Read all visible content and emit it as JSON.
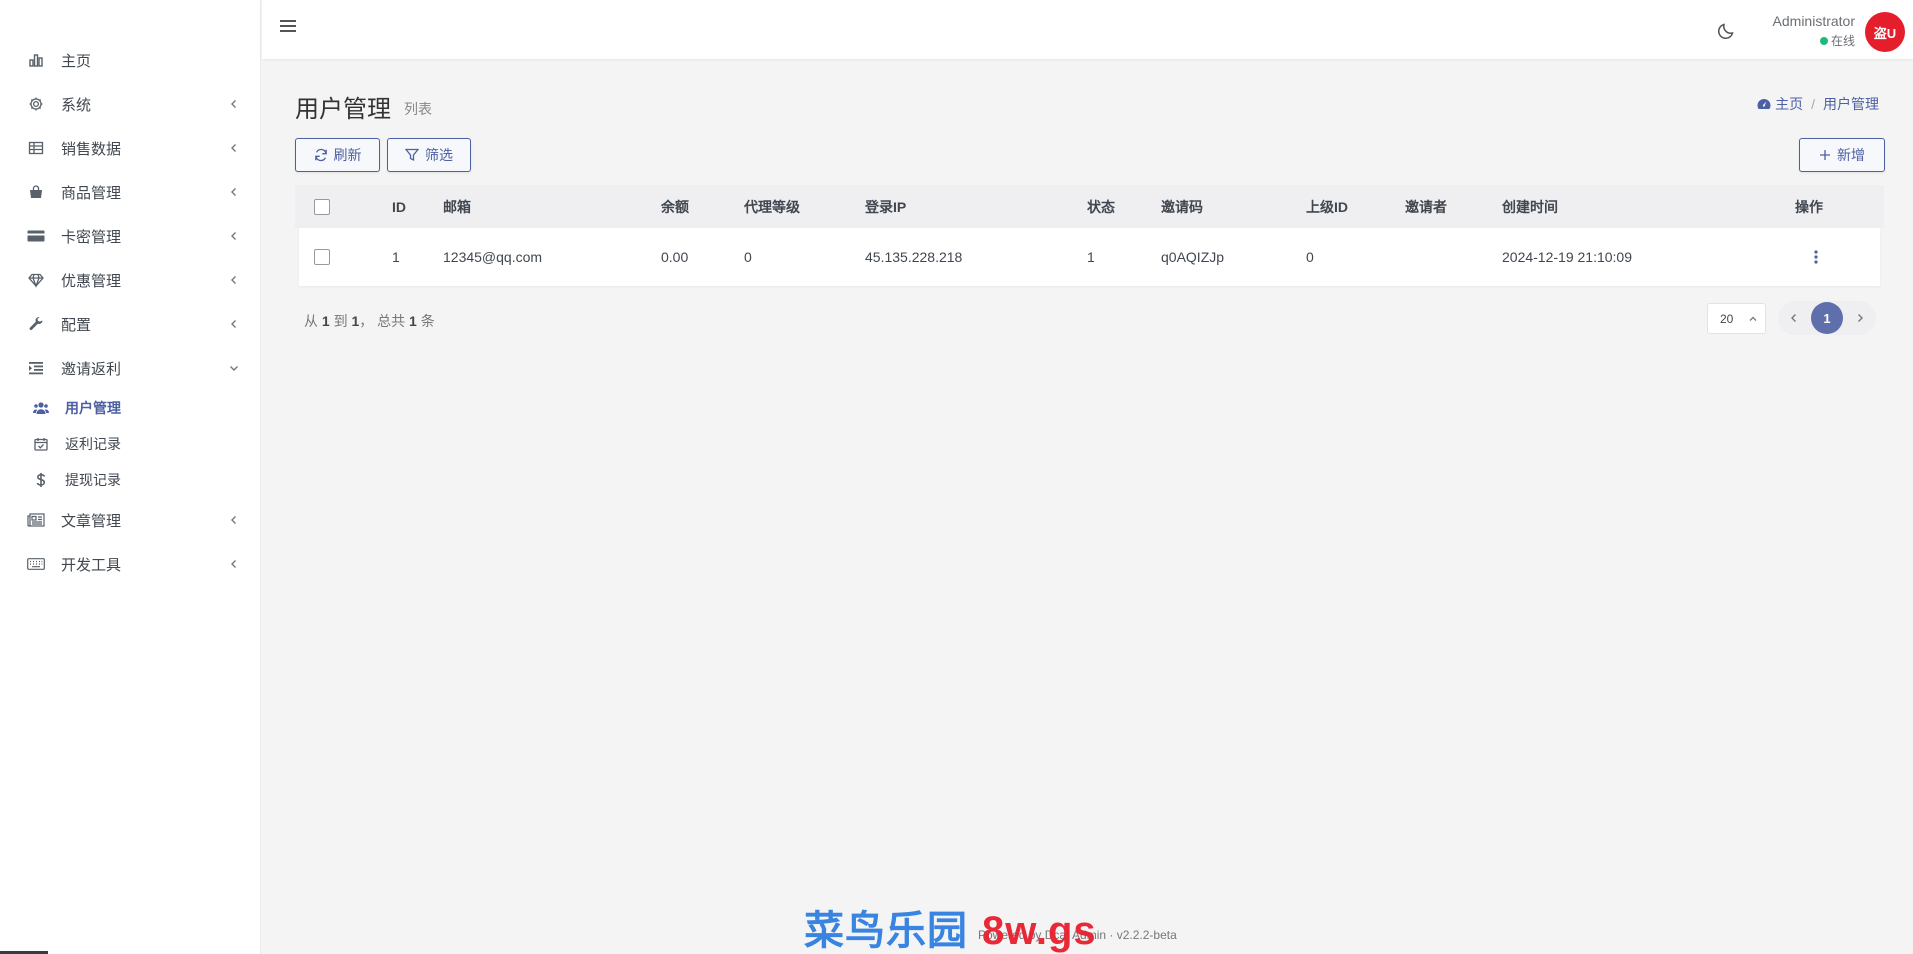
{
  "sidebar": {
    "items": [
      {
        "label": "主页",
        "icon": "bar-chart-icon",
        "arrow": false
      },
      {
        "label": "系统",
        "icon": "gear-icon",
        "arrow": true
      },
      {
        "label": "销售数据",
        "icon": "table-icon",
        "arrow": true
      },
      {
        "label": "商品管理",
        "icon": "shopping-bag-icon",
        "arrow": true
      },
      {
        "label": "卡密管理",
        "icon": "credit-card-icon",
        "arrow": true
      },
      {
        "label": "优惠管理",
        "icon": "diamond-icon",
        "arrow": true
      },
      {
        "label": "配置",
        "icon": "wrench-icon",
        "arrow": true
      },
      {
        "label": "邀请返利",
        "icon": "indent-icon",
        "arrow": true,
        "expanded": true
      }
    ],
    "sub_items": [
      {
        "label": "用户管理",
        "icon": "users-icon",
        "active": true
      },
      {
        "label": "返利记录",
        "icon": "calendar-check-icon",
        "active": false
      },
      {
        "label": "提现记录",
        "icon": "dollar-icon",
        "active": false
      }
    ],
    "items_after": [
      {
        "label": "文章管理",
        "icon": "newspaper-icon",
        "arrow": true
      },
      {
        "label": "开发工具",
        "icon": "keyboard-icon",
        "arrow": true
      }
    ]
  },
  "topbar": {
    "user_name": "Administrator",
    "user_status": "在线",
    "avatar_text": "盗U",
    "status_color": "#21b978",
    "avatar_color": "#e41e2b"
  },
  "page": {
    "title": "用户管理",
    "subtitle": "列表",
    "breadcrumb_home": "主页",
    "breadcrumb_sep": "/",
    "breadcrumb_current": "用户管理"
  },
  "toolbar": {
    "refresh_label": "刷新",
    "filter_label": "筛选",
    "add_label": "新增"
  },
  "table": {
    "columns": [
      "ID",
      "邮箱",
      "余额",
      "代理等级",
      "登录IP",
      "状态",
      "邀请码",
      "上级ID",
      "邀请者",
      "创建时间",
      "操作"
    ],
    "rows": [
      [
        "1",
        "12345@qq.com",
        "0.00",
        "0",
        "45.135.228.218",
        "1",
        "q0AQIZJp",
        "0",
        "",
        "2024-12-19 21:10:09"
      ]
    ]
  },
  "pagination": {
    "summary_from": "从",
    "summary_start": "1",
    "summary_to": "到",
    "summary_end": "1",
    "summary_total_label": "， 总共",
    "summary_total": "1",
    "summary_unit": "条",
    "per_page": "20",
    "current_page": "1"
  },
  "footer": {
    "text": "Powered by Dcat Admin · v2.2.2-beta"
  },
  "watermark": {
    "text_blue": "菜鸟乐园",
    "text_red": "8w.gs"
  },
  "colors": {
    "accent": "#4c60a3",
    "pager_active": "#5f6fab"
  }
}
